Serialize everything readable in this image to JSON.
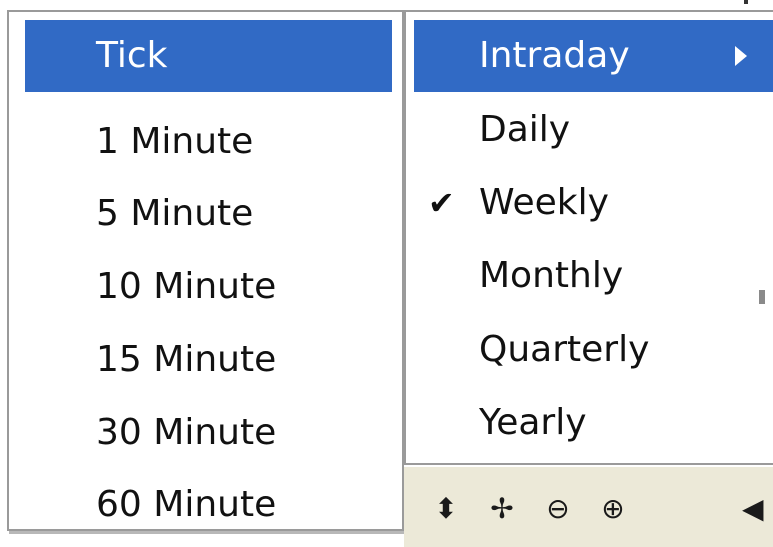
{
  "left_menu": {
    "items": [
      {
        "label": "Tick",
        "selected": true
      },
      {
        "label": "1 Minute"
      },
      {
        "label": "5 Minute"
      },
      {
        "label": "10 Minute"
      },
      {
        "label": "15 Minute"
      },
      {
        "label": "30 Minute"
      },
      {
        "label": "60 Minute"
      }
    ]
  },
  "right_menu": {
    "items": [
      {
        "label": "Intraday",
        "selected": true,
        "has_submenu": true
      },
      {
        "label": "Daily"
      },
      {
        "label": "Weekly",
        "checked": true
      },
      {
        "label": "Monthly"
      },
      {
        "label": "Quarterly"
      },
      {
        "label": "Yearly"
      }
    ]
  },
  "toolbar": {
    "buttons": [
      {
        "icon": "vertical-resize-icon",
        "glyph": "⬍"
      },
      {
        "icon": "move-icon",
        "glyph": "✢"
      },
      {
        "icon": "zoom-out-icon",
        "glyph": "⊖"
      },
      {
        "icon": "zoom-in-icon",
        "glyph": "⊕"
      }
    ]
  },
  "colors": {
    "selection": "#316ac5",
    "toolbar_bg": "#ece9d8",
    "menu_border": "#9a9a9a"
  }
}
